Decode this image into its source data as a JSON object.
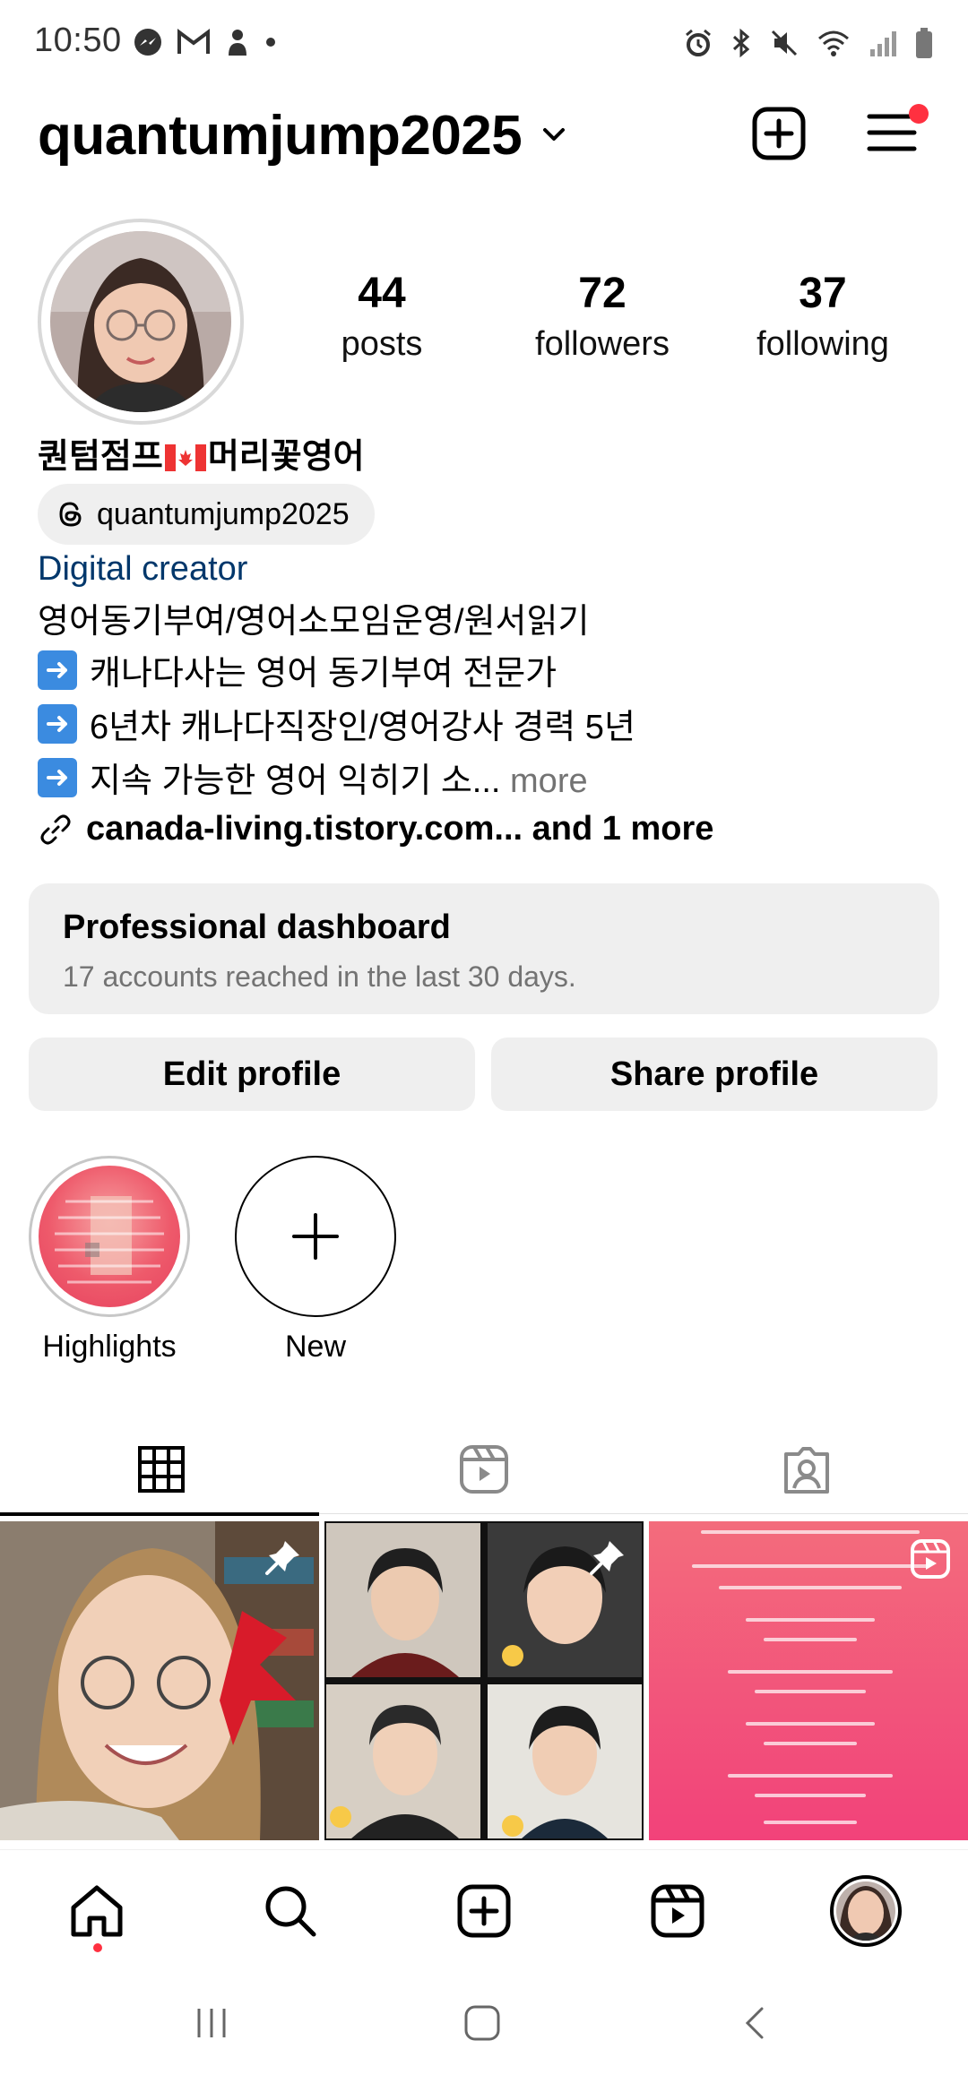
{
  "status_bar": {
    "time": "10:50",
    "left_icons": [
      "messenger-icon",
      "gmail-icon",
      "person-icon",
      "dot-icon"
    ],
    "right_icons": [
      "alarm-icon",
      "bluetooth-icon",
      "mute-icon",
      "wifi-icon",
      "signal-icon",
      "battery-icon"
    ]
  },
  "header": {
    "username": "quantumjump2025",
    "notification_dot_color": "#ff3040"
  },
  "profile": {
    "stats": [
      {
        "count": "44",
        "label": "posts"
      },
      {
        "count": "72",
        "label": "followers"
      },
      {
        "count": "37",
        "label": "following"
      }
    ],
    "display_name_prefix": "퀀텀점프",
    "display_name_suffix": "머리꽃영어",
    "threads_handle": "quantumjump2025",
    "category": "Digital creator",
    "bio_first_line": "영어동기부여/영어소모임운영/원서읽기",
    "bio_arrow_lines": [
      "캐나다사는 영어 동기부여 전문가",
      "6년차 캐나다직장인/영어강사 경력 5년"
    ],
    "bio_truncated": "지속 가능한 영어 익히기 소...",
    "bio_more": " more",
    "link_text": "canada-living.tistory.com... and 1 more",
    "category_color": "#00376b"
  },
  "dashboard": {
    "title": "Professional dashboard",
    "subtitle": "17 accounts reached in the last 30 days."
  },
  "actions": {
    "edit_label": "Edit profile",
    "share_label": "Share profile"
  },
  "highlights": {
    "items": [
      {
        "label": "Highlights"
      },
      {
        "label": "New"
      }
    ]
  },
  "tabs": [
    "posts-grid-icon",
    "reels-icon",
    "tagged-icon"
  ],
  "bottom_nav": [
    "home-icon",
    "search-icon",
    "create-icon",
    "reels-icon",
    "profile-avatar"
  ],
  "system_nav": [
    "recents-icon",
    "home-icon",
    "back-icon"
  ]
}
